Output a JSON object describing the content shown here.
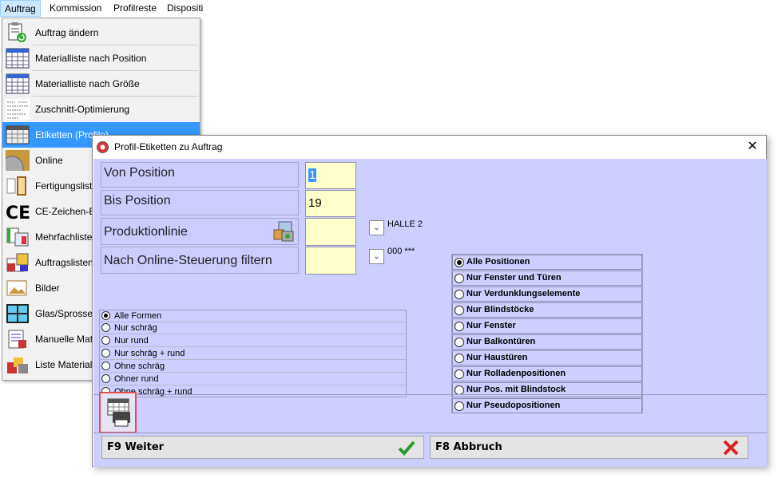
{
  "menubar": {
    "items": [
      "Auftrag",
      "Kommission",
      "Profilreste",
      "Dispositi"
    ]
  },
  "dropdown": {
    "items": [
      {
        "label": "Auftrag ändern",
        "icon": "clipboard-refresh-icon"
      },
      {
        "label": "Materialliste nach Position",
        "icon": "table-icon"
      },
      {
        "label": "Materialliste nach Größe",
        "icon": "table-icon"
      },
      {
        "label": "Zuschnitt-Optimierung",
        "icon": "cutting-list-icon"
      },
      {
        "label": "Etiketten (Profile)",
        "icon": "labels-icon"
      },
      {
        "label": "Online",
        "icon": "saw-blade-icon"
      },
      {
        "label": "Fertigungslist",
        "icon": "window-frame-icon"
      },
      {
        "label": "CE-Zeichen-E",
        "icon": "ce-mark-icon"
      },
      {
        "label": "Mehrfachliste",
        "icon": "multi-list-icon"
      },
      {
        "label": "Auftragslisten",
        "icon": "order-lists-icon"
      },
      {
        "label": "Bilder",
        "icon": "pictures-icon"
      },
      {
        "label": "Glas/Sprosser",
        "icon": "glass-muntin-icon"
      },
      {
        "label": "Manuelle Mat",
        "icon": "manual-material-icon"
      },
      {
        "label": "Liste Material",
        "icon": "material-list-icon"
      }
    ],
    "selected_index": 4
  },
  "dialog": {
    "title": "Profil-Etiketten zu Auftrag",
    "close_label": "✕",
    "fields": {
      "von_label": "Von Position",
      "von_value": "1",
      "bis_label": "Bis Position",
      "bis_value": "19",
      "prod_label": "Produktionlinie",
      "prod_value": "HALLE 2",
      "online_label": "Nach Online-Steuerung filtern",
      "online_value": "000 ***"
    },
    "forms_group": {
      "options": [
        "Alle Formen",
        "Nur schräg",
        "Nur rund",
        "Nur schräg + rund",
        "Ohne schräg",
        "Ohner rund",
        "Ohne schräg + rund"
      ],
      "selected": 0
    },
    "positions_group": {
      "options": [
        "Alle Positionen",
        "Nur Fenster und Türen",
        "Nur Verdunklungselemente",
        "Nur Blindstöcke",
        "Nur Fenster",
        "Nur Balkontüren",
        "Nur Haustüren",
        "Nur Rolladenpositionen",
        "Nur Pos. mit Blindstock",
        "Nur Pseudopositionen"
      ],
      "selected": 0
    },
    "buttons": {
      "weiter": "F9 Weiter",
      "abbruch": "F8 Abbruch"
    },
    "colors": {
      "client_bg": "#cccfff",
      "input_bg": "#ffffcc",
      "selection": "#3399ff"
    }
  }
}
